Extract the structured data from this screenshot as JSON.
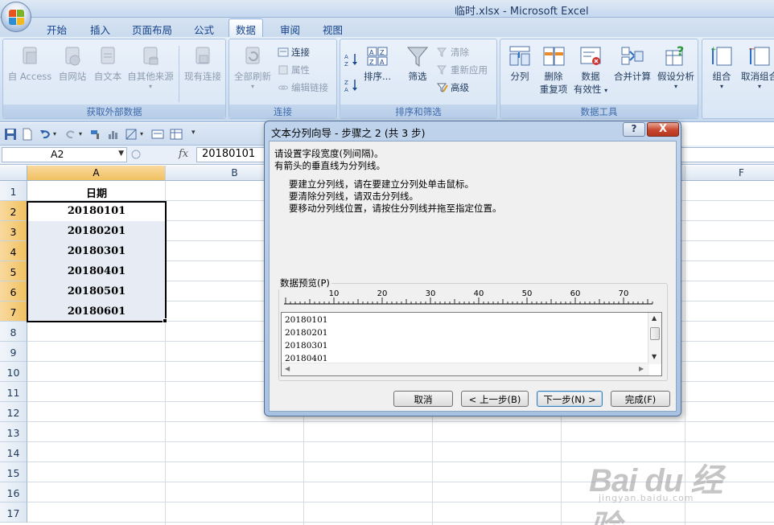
{
  "window": {
    "title": "临时.xlsx - Microsoft Excel"
  },
  "tabs": [
    "开始",
    "插入",
    "页面布局",
    "公式",
    "数据",
    "审阅",
    "视图"
  ],
  "active_tab": "数据",
  "ribbon": {
    "external_data": {
      "label": "获取外部数据",
      "access": "自 Access",
      "web": "自网站",
      "text": "自文本",
      "other": "自其他来源",
      "existing": "现有连接"
    },
    "connections": {
      "label": "连接",
      "refresh_all": "全部刷新",
      "connections": "连接",
      "properties": "属性",
      "edit_links": "编辑链接"
    },
    "sort_filter": {
      "label": "排序和筛选",
      "sort": "排序...",
      "filter": "筛选",
      "clear": "清除",
      "reapply": "重新应用",
      "advanced": "高级"
    },
    "data_tools": {
      "label": "数据工具",
      "split": "分列",
      "remove_dup_1": "删除",
      "remove_dup_2": "重复项",
      "validation_1": "数据",
      "validation_2": "有效性",
      "consolidate": "合并计算",
      "whatif": "假设分析"
    },
    "outline": {
      "group": "组合",
      "ungroup": "取消组合"
    }
  },
  "formula_bar": {
    "name_box": "A2",
    "fx": "fx",
    "value": "20180101"
  },
  "sheet": {
    "columns": [
      "A",
      "B",
      "F"
    ],
    "rows": [
      "1",
      "2",
      "3",
      "4",
      "5",
      "6",
      "7",
      "8",
      "9",
      "10",
      "11",
      "12",
      "13",
      "14",
      "15",
      "16",
      "17"
    ],
    "cells": [
      "日期",
      "20180101",
      "20180201",
      "20180301",
      "20180401",
      "20180501",
      "20180601"
    ]
  },
  "dialog": {
    "title": "文本分列向导 - 步骤之 2 (共 3 步)",
    "help": "?",
    "close": "X",
    "intro_1": "请设置字段宽度(列间隔)。",
    "intro_2": "有箭头的垂直线为分列线。",
    "tip_1": "要建立分列线，请在要建立分列处单击鼠标。",
    "tip_2": "要清除分列线，请双击分列线。",
    "tip_3": "要移动分列线位置，请按住分列线并拖至指定位置。",
    "preview_label": "数据预览(P)",
    "ruler_ticks": [
      "10",
      "20",
      "30",
      "40",
      "50",
      "60",
      "70"
    ],
    "preview_lines": [
      "20180101",
      "20180201",
      "20180301",
      "20180401"
    ],
    "buttons": {
      "cancel": "取消",
      "back": "< 上一步(B)",
      "next": "下一步(N) >",
      "finish": "完成(F)"
    }
  },
  "watermark": {
    "logo": "Bai du 经验",
    "url": "jingyan.baidu.com"
  }
}
